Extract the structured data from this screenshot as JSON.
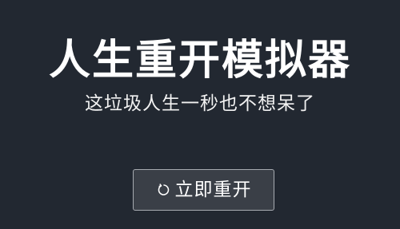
{
  "title": "人生重开模拟器",
  "subtitle": "这垃圾人生一秒也不想呆了",
  "restart_button": {
    "label": "立即重开",
    "icon": "restart-icon"
  },
  "colors": {
    "background": "#222831",
    "button_background": "#3a3f47",
    "button_border": "#a7abb1",
    "text": "#ffffff"
  }
}
